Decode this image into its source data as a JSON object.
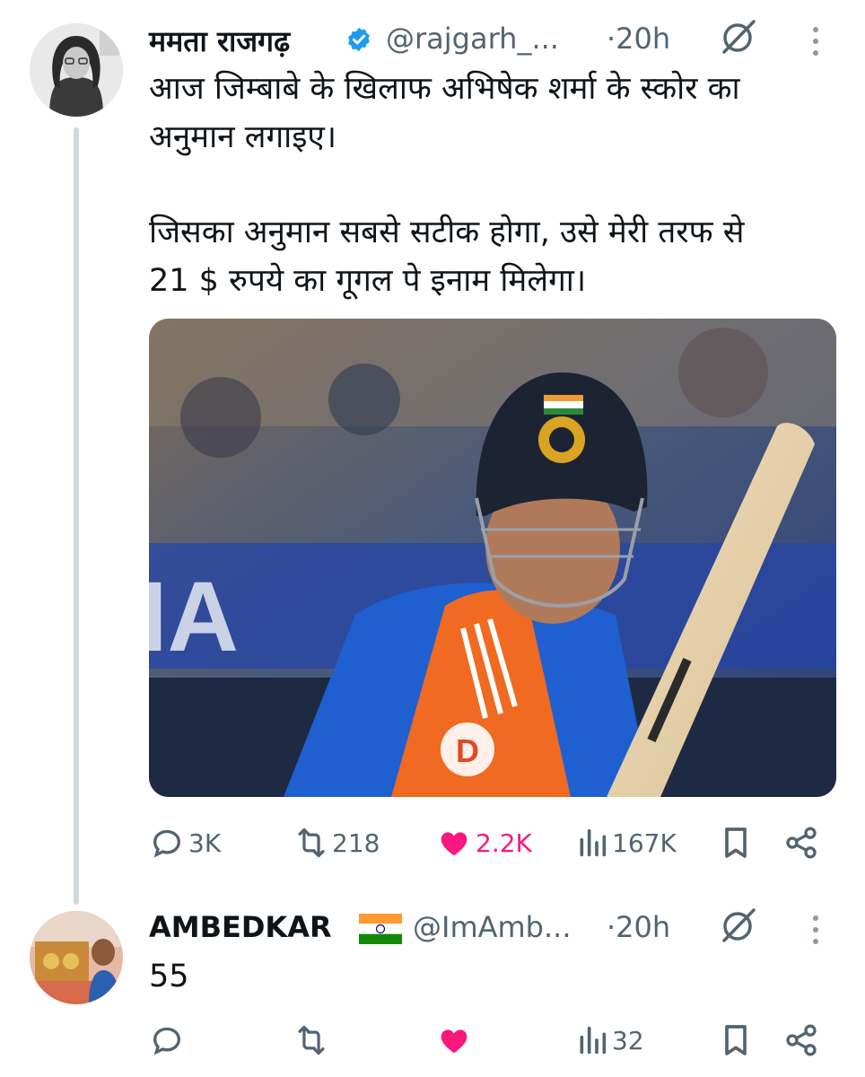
{
  "tweet": {
    "author_name": "ममता राजगढ़",
    "handle": "@rajgarh_...",
    "time": "·20h",
    "body_lines": [
      "आज जिम्बाबे के खिलाफ अभिषेक शर्मा के स्कोर का",
      "अनुमान लगाइए।",
      "जिसका अनुमान सबसे सटीक होगा, उसे मेरी तरफ से",
      "21 $ रुपये का गूगल पे इनाम मिलेगा।"
    ],
    "media": {
      "banner_text": "IA",
      "jersey_logo": "D"
    },
    "actions": {
      "replies": "3K",
      "reposts": "218",
      "likes": "2.2K",
      "views": "167K"
    }
  },
  "reply": {
    "author_name": "AMBEDKAR",
    "handle": "@ImAmb...",
    "time": "·20h",
    "body": "55",
    "actions": {
      "replies": "",
      "reposts": "",
      "likes": "",
      "views": "32"
    }
  },
  "colors": {
    "accent_like": "#f91880",
    "verified": "#1d9bf0",
    "muted": "#536471"
  },
  "icons": [
    "verified-badge-icon",
    "grok-icon",
    "more-icon",
    "reply-icon",
    "repost-icon",
    "like-icon",
    "views-icon",
    "bookmark-icon",
    "share-icon",
    "india-flag-icon"
  ]
}
